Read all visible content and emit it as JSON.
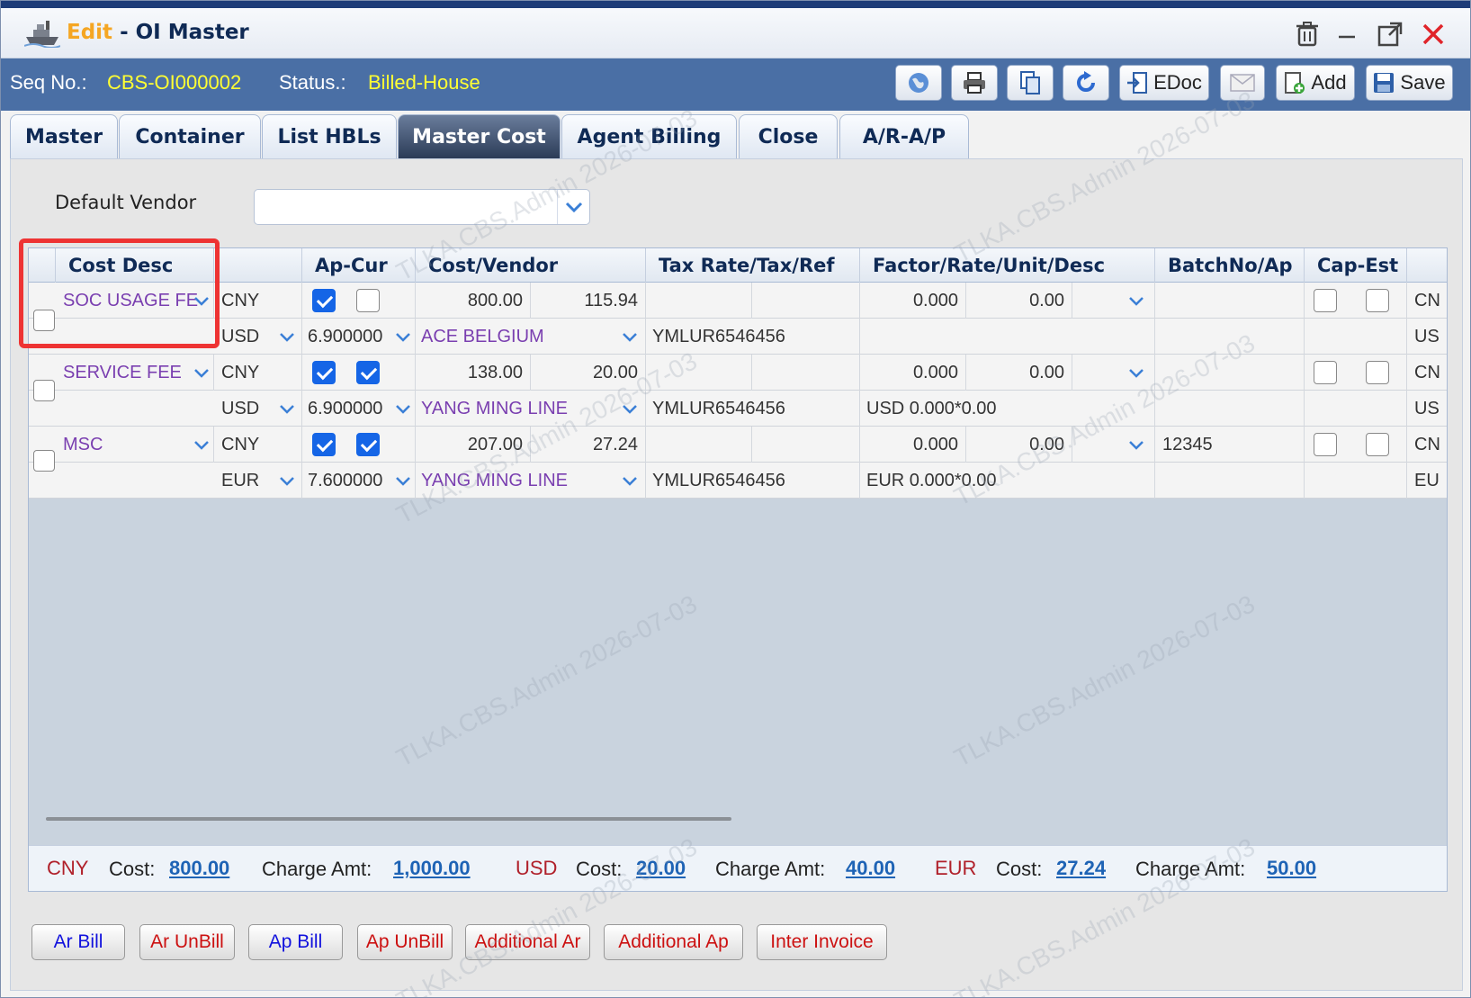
{
  "window": {
    "title_mode": "Edit",
    "title_separator": " - ",
    "title_name": "OI Master"
  },
  "header": {
    "seq_label": "Seq No.:",
    "seq_value": "CBS-OI000002",
    "status_label": "Status.:",
    "status_value": "Billed-House",
    "edoc_label": "EDoc",
    "add_label": "Add",
    "save_label": "Save"
  },
  "tabs": [
    "Master",
    "Container",
    "List HBLs",
    "Master Cost",
    "Agent Billing",
    "Close",
    "A/R-A/P"
  ],
  "active_tab": "Master Cost",
  "default_vendor": {
    "label": "Default Vendor",
    "value": ""
  },
  "grid": {
    "columns": [
      "Cost Desc",
      "Ap-Cur",
      "Cost/Vendor",
      "Tax Rate/Tax/Ref",
      "Factor/Rate/Unit/Desc",
      "BatchNo/Ap",
      "Cap-Est"
    ],
    "rows": [
      {
        "desc": "SOC USAGE FE",
        "cur": "CNY",
        "chk1": true,
        "chk2": false,
        "cost": "800.00",
        "charge": "115.94",
        "factor": "0.000",
        "rate": "0.00",
        "batch": "",
        "edge1": "CN",
        "cur2": "USD",
        "exrate": "6.900000",
        "vendor": "ACE BELGIUM",
        "ref": "YMLUR6546456",
        "desc2": "",
        "edge2": "US"
      },
      {
        "desc": "SERVICE FEE",
        "cur": "CNY",
        "chk1": true,
        "chk2": true,
        "cost": "138.00",
        "charge": "20.00",
        "factor": "0.000",
        "rate": "0.00",
        "batch": "",
        "edge1": "CN",
        "cur2": "USD",
        "exrate": "6.900000",
        "vendor": "YANG MING LINE",
        "ref": "YMLUR6546456",
        "desc2": "USD 0.000*0.00",
        "edge2": "US"
      },
      {
        "desc": "MSC",
        "cur": "CNY",
        "chk1": true,
        "chk2": true,
        "cost": "207.00",
        "charge": "27.24",
        "factor": "0.000",
        "rate": "0.00",
        "batch": "12345",
        "edge1": "CN",
        "cur2": "EUR",
        "exrate": "7.600000",
        "vendor": "YANG MING LINE",
        "ref": "YMLUR6546456",
        "desc2": "EUR 0.000*0.00",
        "edge2": "EU"
      }
    ]
  },
  "summary": {
    "cost_label": "Cost:",
    "charge_label": "Charge Amt:",
    "items": [
      {
        "cur": "CNY",
        "cost": "800.00",
        "charge": "1,000.00"
      },
      {
        "cur": "USD",
        "cost": "20.00",
        "charge": "40.00"
      },
      {
        "cur": "EUR",
        "cost": "27.24",
        "charge": "50.00"
      }
    ]
  },
  "bottom_buttons": [
    "Ar Bill",
    "Ar UnBill",
    "Ap Bill",
    "Ap UnBill",
    "Additional Ar",
    "Additional Ap",
    "Inter Invoice"
  ],
  "watermark": "TLKA.CBS.Admin 2026-07-03",
  "colors": {
    "title_bar": "#4a6fa5",
    "status_text": "#ffff33",
    "purple_text": "#7a3fb0",
    "check_blue": "#1565e6",
    "highlight": "#ee3333"
  }
}
